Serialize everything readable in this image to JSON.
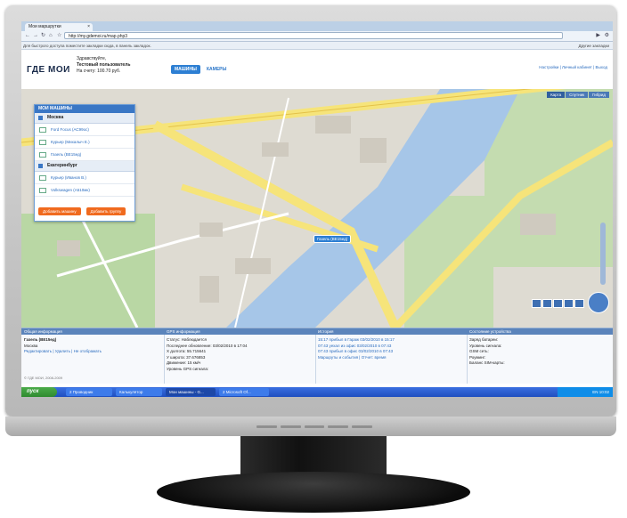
{
  "browser": {
    "tab_title": "Мои маршрутки",
    "tab_close": "×",
    "url_prefix": "http://",
    "url_host": "my.gdemoi.ru",
    "url_path": "/map.php3",
    "bookmarks_hint": "Для быстрого доступа поместите закладки сюда, в панель закладок.",
    "other_bookmarks": "Другие закладки"
  },
  "site": {
    "logo": "ГДЕ МОИ",
    "greeting": "Здравствуйте,",
    "username": "Тестовый пользователь",
    "balance": "На счету: 100.70 руб.",
    "nav": [
      {
        "label": "МАШИНЫ",
        "active": true
      },
      {
        "label": "КАМЕРЫ",
        "active": false
      }
    ],
    "header_links": "Настройки | Личный кабинет | Выход"
  },
  "map": {
    "tabs": [
      "Карта",
      "Спутник",
      "Гибрид"
    ],
    "marker_label": "Газель (ВЕ15ед)",
    "panel_title": "МОИ МАШИНЫ",
    "groups": [
      {
        "name": "Москва",
        "vehicles": [
          "Ford Focus (АС99ос)",
          "Курьер (Михалыч Е.)",
          "Газель (ВЕ15ед)"
        ]
      },
      {
        "name": "Екатеринбург",
        "vehicles": [
          "Курьер (Иванов В.)",
          "Volkswagen (А510мк)"
        ]
      }
    ],
    "add_car_button": "Добавить машину",
    "add_group_button": "Добавить группу"
  },
  "info": {
    "general": {
      "title": "Общая информация",
      "name": "Газель (ВЕ15ед)",
      "city": "Москва",
      "links": "Редактировать | Удалить | Не отображать"
    },
    "gps": {
      "title": "GPS информация",
      "status": "Статус: Наблюдается",
      "updated": "Последнее обновление: 03/02/2010 в 17:04",
      "lon": "Х долгота: 55.715641",
      "lat": "У широта: 37.676853",
      "movement": "Движение: 15 км/ч",
      "signal": "Уровень GPS сигнала:"
    },
    "history": {
      "title": "История",
      "events": [
        "15:17 прибыл в Гараж 03/02/2010 в 15:17",
        "07:43 уехал из офис 03/02/2010 в 07:43",
        "07:43 прибыл в офис 03/02/2010 в 07:43"
      ],
      "links": "Маршруты и события | Отчет: время"
    },
    "device": {
      "title": "Состояние устройства",
      "lines": [
        "Заряд батареи:",
        "Уровень сигнала:",
        "GSM сеть:",
        "Роуминг:",
        "Баланс SIM-карты:"
      ]
    },
    "copyright": "© ГДЕ МОИ, 2008-2009"
  },
  "taskbar": {
    "start": "пуск",
    "tasks": [
      "2 Проводник",
      "Калькулятор",
      "Мои машины - G...",
      "2 Microsoft Of..."
    ],
    "tray": "EN  10:02"
  }
}
